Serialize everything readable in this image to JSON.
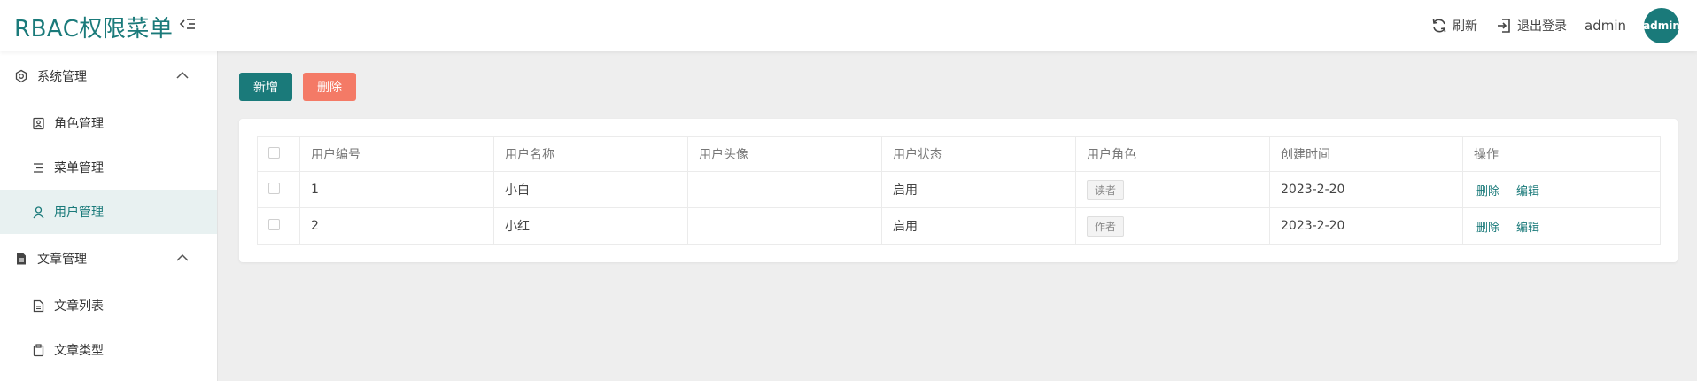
{
  "header": {
    "title": "RBAC权限菜单",
    "refresh_label": "刷新",
    "logout_label": "退出登录",
    "username": "admin",
    "avatar_text": "admin"
  },
  "sidebar": {
    "groups": [
      {
        "label": "系统管理",
        "icon": "settings-icon",
        "items": [
          {
            "label": "角色管理",
            "icon": "id-card-icon"
          },
          {
            "label": "菜单管理",
            "icon": "menu-list-icon"
          },
          {
            "label": "用户管理",
            "icon": "user-icon",
            "active": true
          }
        ]
      },
      {
        "label": "文章管理",
        "icon": "document-filled-icon",
        "items": [
          {
            "label": "文章列表",
            "icon": "document-icon"
          },
          {
            "label": "文章类型",
            "icon": "clipboard-icon"
          }
        ]
      }
    ]
  },
  "toolbar": {
    "add_label": "新增",
    "delete_label": "删除"
  },
  "table": {
    "columns": [
      "用户编号",
      "用户名称",
      "用户头像",
      "用户状态",
      "用户角色",
      "创建时间",
      "操作"
    ],
    "rows": [
      {
        "id": "1",
        "name": "小白",
        "avatar": "",
        "status": "启用",
        "role": "读者",
        "created": "2023-2-20"
      },
      {
        "id": "2",
        "name": "小红",
        "avatar": "",
        "status": "启用",
        "role": "作者",
        "created": "2023-2-20"
      }
    ],
    "action_delete": "删除",
    "action_edit": "编辑"
  },
  "colors": {
    "primary": "#1a7a7a",
    "danger": "#f47a66",
    "active_bg": "#e8f1f1",
    "page_bg": "#eeeeee"
  }
}
